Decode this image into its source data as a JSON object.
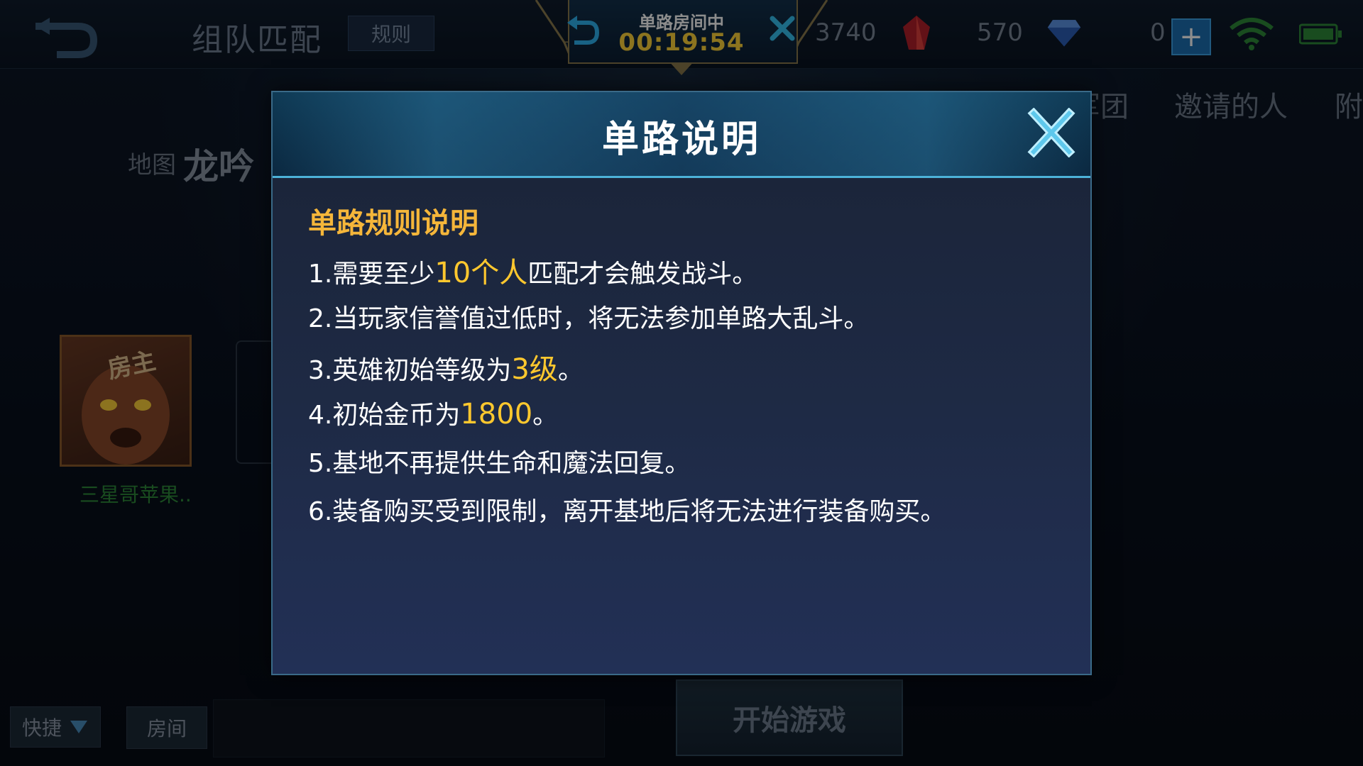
{
  "header": {
    "title": "组队匹配",
    "rules_label": "规则",
    "stats": {
      "gold": "3740",
      "tickets": "570",
      "diamonds": "0"
    }
  },
  "room_banner": {
    "label": "单路房间中",
    "timer": "00:19:54"
  },
  "right_tabs": [
    "军团",
    "邀请的人",
    "附"
  ],
  "map": {
    "label": "地图",
    "name": "龙吟"
  },
  "player": {
    "badge": "房主",
    "name": "三星哥苹果.."
  },
  "bottom": {
    "quick_label": "快捷",
    "room_label": "房间",
    "start_label": "开始游戏"
  },
  "dialog": {
    "title": "单路说明",
    "section_heading": "单路规则说明",
    "rules": [
      {
        "prefix": "1.需要至少",
        "highlight": "10个人",
        "suffix": "匹配才会触发战斗。"
      },
      {
        "prefix": "2.当玩家信誉值过低时，将无法参加单路大乱斗。",
        "highlight": "",
        "suffix": ""
      },
      {
        "prefix": "3.英雄初始等级为",
        "highlight": "3级",
        "suffix": "。"
      },
      {
        "prefix": "4.初始金币为",
        "highlight": "1800",
        "suffix": "。"
      },
      {
        "prefix": "5.基地不再提供生命和魔法回复。",
        "highlight": "",
        "suffix": ""
      },
      {
        "prefix": "6.装备购买受到限制，离开基地后将无法进行装备购买。",
        "highlight": "",
        "suffix": ""
      }
    ]
  },
  "colors": {
    "highlight": "#ffc82e",
    "heading": "#f5b63a",
    "accent": "#4cb2d8",
    "timer": "#ffd43a"
  }
}
